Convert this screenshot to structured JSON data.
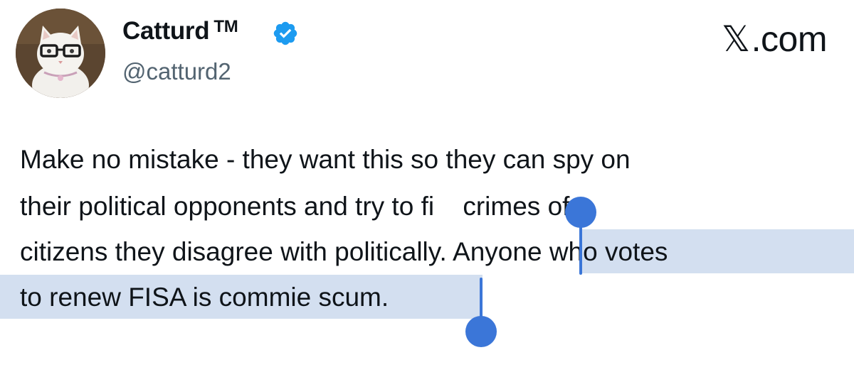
{
  "author": {
    "display_name": "Catturd",
    "trademark": "TM",
    "handle": "@catturd2",
    "verified_icon": "verified-badge-icon"
  },
  "site": {
    "label": ".com",
    "logo_glyph": "𝕏"
  },
  "tweet": {
    "lines": [
      "Make no mistake - they want this so they can spy on",
      "their political opponents and try to fi",
      "citizens they disagree with politically. ",
      "to renew FISA is commie scum."
    ],
    "line2_tail": " crimes of",
    "line3_selected": "Anyone who votes"
  },
  "colors": {
    "selection": "#d3dff0",
    "handle": "#3b76d8",
    "verified": "#1d9bf0",
    "handle_text": "#536471"
  }
}
